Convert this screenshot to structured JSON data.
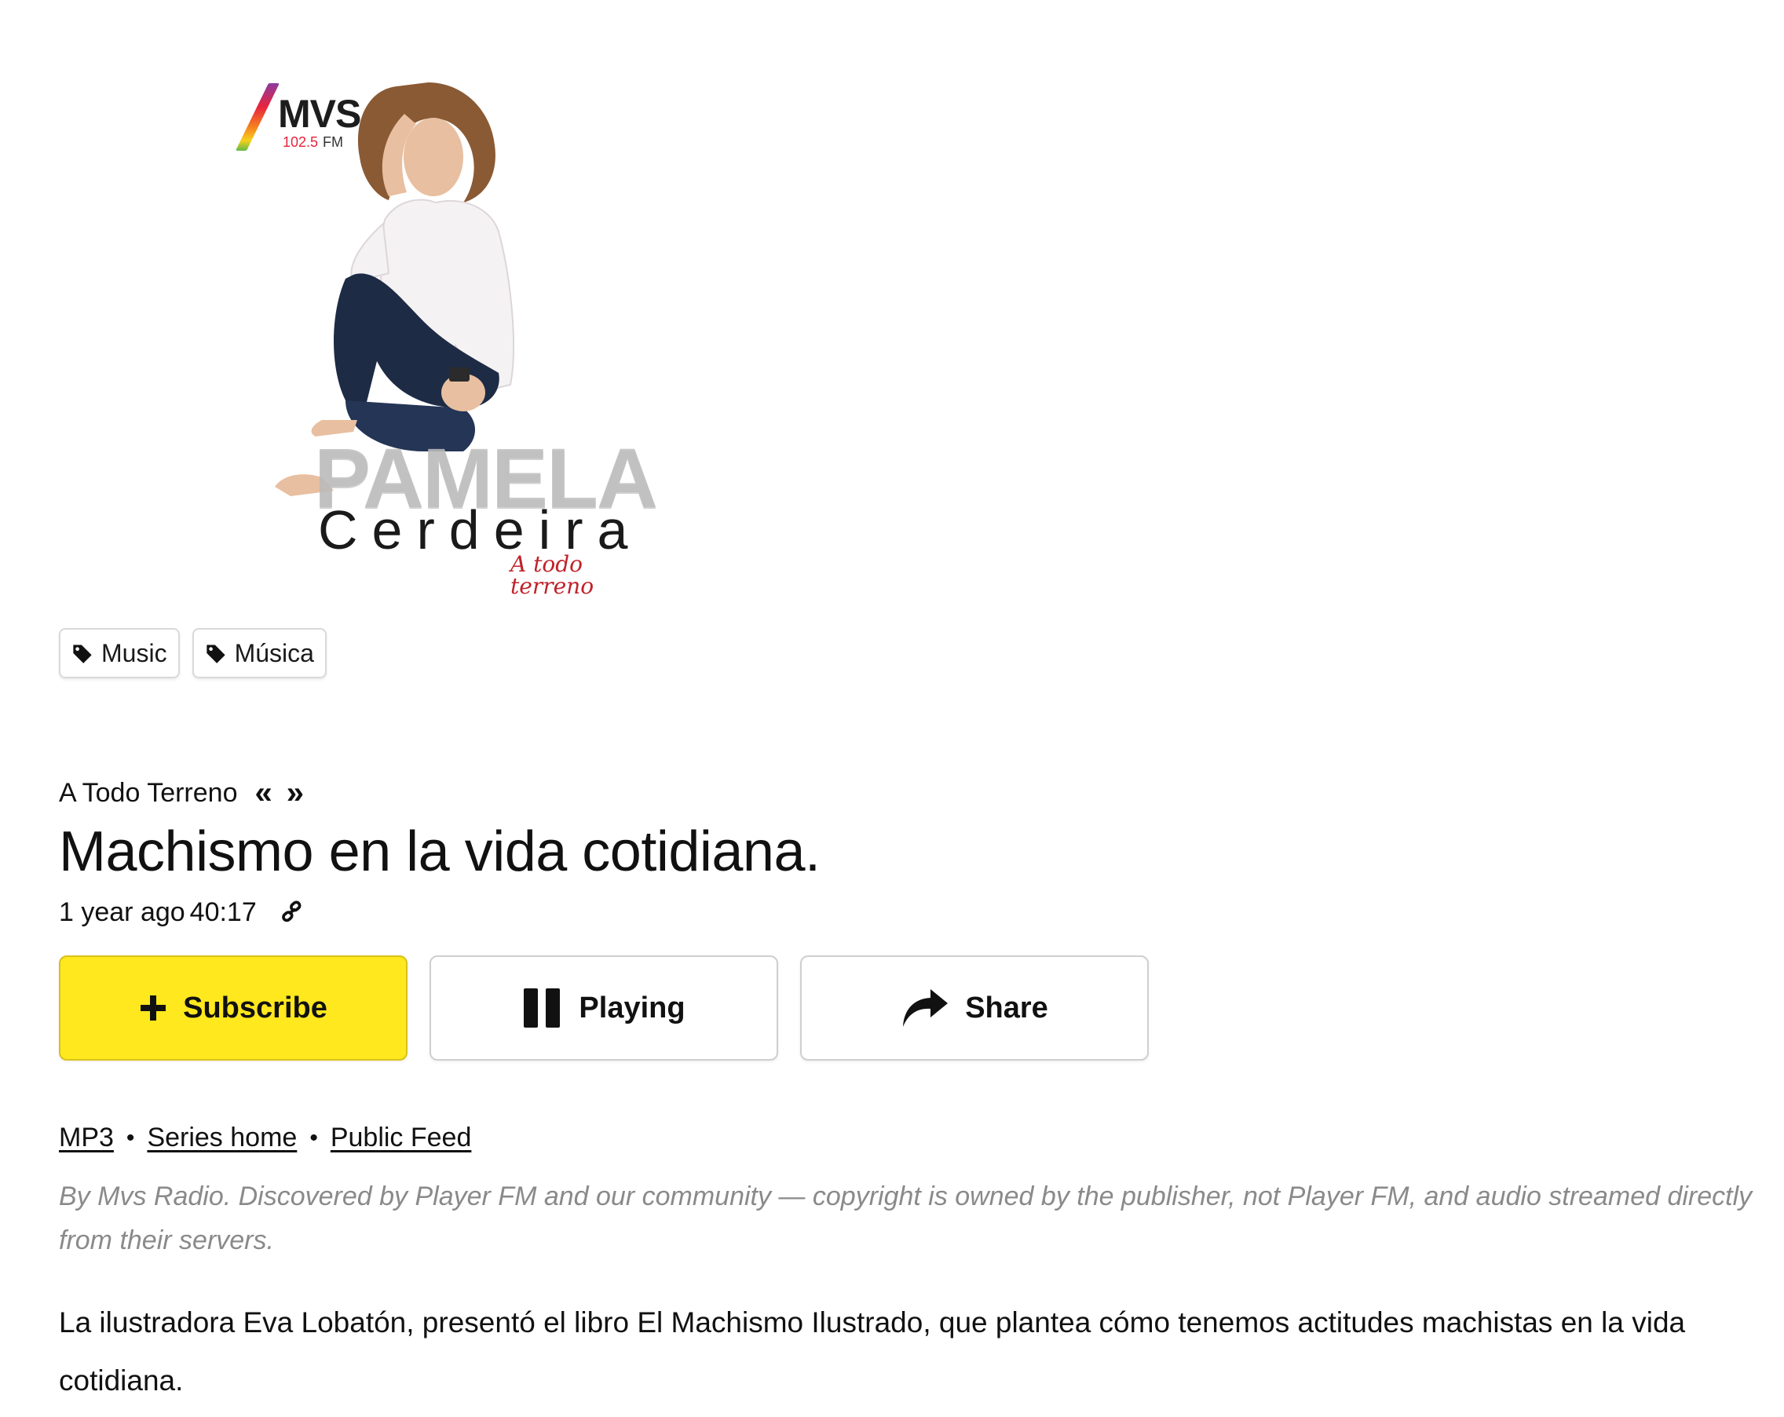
{
  "cover": {
    "logo_text": "MVS",
    "logo_frequency": "102.5",
    "logo_band": "FM",
    "name_first": "PAMELA",
    "name_last": "Cerdeira",
    "tagline": "A todo terreno"
  },
  "tags": [
    {
      "label": "Music",
      "icon": "tag-icon"
    },
    {
      "label": "Música",
      "icon": "tag-icon"
    }
  ],
  "episode": {
    "series_name": "A Todo Terreno",
    "prev_label": "«",
    "next_label": "»",
    "title": "Machismo en la vida cotidiana.",
    "age": "1 year ago",
    "duration": "40:17"
  },
  "actions": {
    "subscribe_label": "Subscribe",
    "playing_label": "Playing",
    "share_label": "Share"
  },
  "links": {
    "mp3": "MP3",
    "series_home": "Series home",
    "public_feed": "Public Feed",
    "separator": "•"
  },
  "attribution": "By Mvs Radio. Discovered by Player FM and our community — copyright is owned by the publisher, not Player FM, and audio streamed directly from their servers.",
  "description": "La ilustradora Eva Lobatón, presentó el libro El Machismo Ilustrado, que plantea cómo tenemos actitudes machistas en la vida cotidiana.",
  "colors": {
    "subscribe_bg": "#ffe81e",
    "attribution_text": "#8a8a8a",
    "tagline": "#c0222a"
  }
}
